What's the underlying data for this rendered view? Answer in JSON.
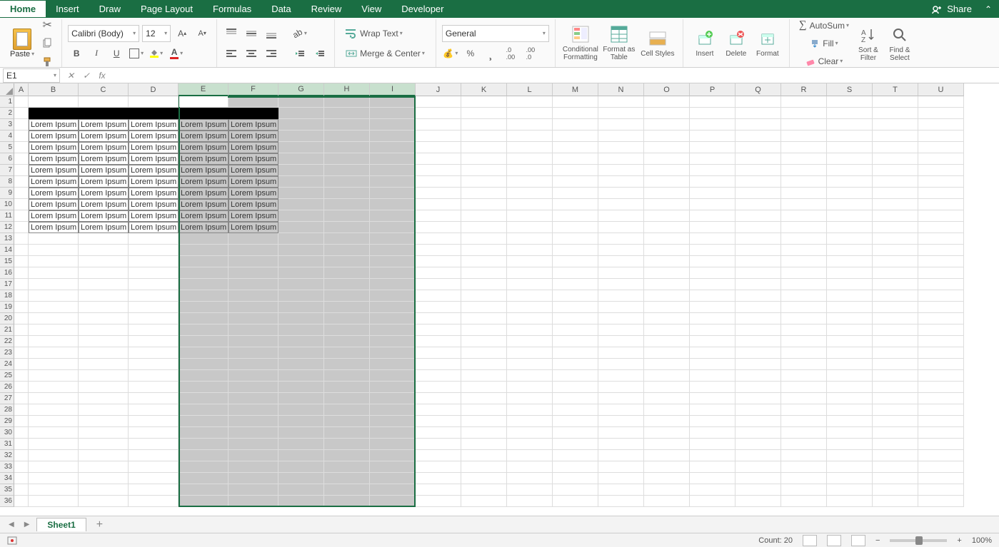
{
  "tabs": [
    "Home",
    "Insert",
    "Draw",
    "Page Layout",
    "Formulas",
    "Data",
    "Review",
    "View",
    "Developer"
  ],
  "active_tab": "Home",
  "share_label": "Share",
  "ribbon": {
    "paste": "Paste",
    "font_name": "Calibri (Body)",
    "font_size": "12",
    "wrap": "Wrap Text",
    "merge": "Merge & Center",
    "number_format": "General",
    "cond_fmt": "Conditional Formatting",
    "fmt_table": "Format as Table",
    "cell_styles": "Cell Styles",
    "insert": "Insert",
    "delete": "Delete",
    "format": "Format",
    "autosum": "AutoSum",
    "fill": "Fill",
    "clear": "Clear",
    "sort": "Sort & Filter",
    "find": "Find & Select"
  },
  "name_box": "E1",
  "columns": [
    "A",
    "B",
    "C",
    "D",
    "E",
    "F",
    "G",
    "H",
    "I",
    "J",
    "K",
    "L",
    "M",
    "N",
    "O",
    "P",
    "Q",
    "R",
    "S",
    "T",
    "U"
  ],
  "column_widths": {
    "default": 64,
    "A": 20,
    "B": 70,
    "C": 70,
    "D": 70,
    "E": 70,
    "F": 70,
    "G": 64,
    "H": 64,
    "I": 64
  },
  "selected_cols": [
    "E",
    "F",
    "G",
    "H",
    "I"
  ],
  "row_count": 36,
  "data_region": {
    "black_header_row": 2,
    "black_cols": [
      "B",
      "C",
      "D",
      "E",
      "F"
    ],
    "cell_text": "Lorem Ipsum",
    "data_rows": [
      3,
      4,
      5,
      6,
      7,
      8,
      9,
      10,
      11,
      12
    ],
    "data_cols": [
      "B",
      "C",
      "D",
      "E",
      "F"
    ]
  },
  "sheet_tabs": [
    "Sheet1"
  ],
  "status": {
    "count": "Count: 20",
    "zoom": "100%"
  }
}
